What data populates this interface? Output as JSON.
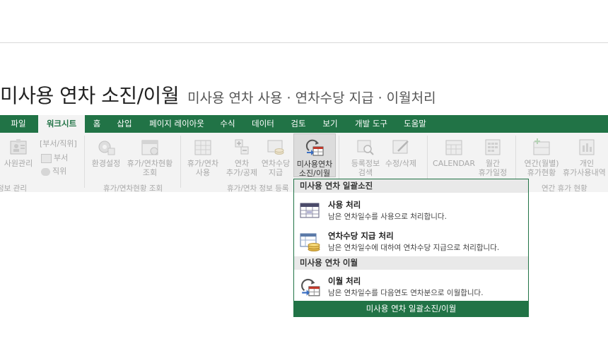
{
  "heading": {
    "title": "미사용 연차 소진/이월",
    "subtitle": "미사용 연차 사용 · 연차수당 지급  · 이월처리"
  },
  "tabs": [
    "파일",
    "워크시트",
    "홈",
    "삽입",
    "페이지 레이아웃",
    "수식",
    "데이터",
    "검토",
    "보기",
    "개발 도구",
    "도움말"
  ],
  "active_tab": "워크시트",
  "ribbon": {
    "buttons": {
      "employee_mgmt": "사원관리",
      "dept_pos": "[부서/직위]",
      "dept": "부서",
      "position": "직위",
      "env_settings": "환경설정",
      "leave_status_1": "휴가/연차현황",
      "leave_status_2": "조회",
      "leave_use_1": "휴가/연차",
      "leave_use_2": "사용",
      "annual_add_1": "연차",
      "annual_add_2": "추가/공제",
      "allowance_1": "연차수당",
      "allowance_2": "지급",
      "unused_1": "미사용연차",
      "unused_2": "소진/이월",
      "reg_search_1": "등록정보",
      "reg_search_2": "검색",
      "edit_delete": "수정/삭제",
      "calendar": "CALENDAR",
      "monthly_1": "월간",
      "monthly_2": "휴가일정",
      "annual_monthly_1": "연간(월별)",
      "annual_monthly_2": "휴가현황",
      "personal_1": "개인",
      "personal_2": "휴가사용내역"
    },
    "groups": {
      "g1": "정보 관리",
      "g2": "휴가/연차현황 조회",
      "g3": "휴가/연차 정보 등록",
      "g4": "연간 휴가 현황"
    }
  },
  "dropdown": {
    "section1": "미사용 연차 일괄소진",
    "item1_title": "사용 처리",
    "item1_desc": "남은 연차일수를 사용으로 처리합니다.",
    "item2_title": "연차수당 지급 처리",
    "item2_desc": "남은 연차일수에 대하여 연차수당 지급으로 처리합니다.",
    "section2": "미사용 연차 이월",
    "item3_title": "이월 처리",
    "item3_desc": "남은 연차일수를 다음연도 연차분으로 이월합니다.",
    "footer": "미사용 연차 일괄소진/이월"
  },
  "colors": {
    "excel_green": "#217346",
    "ribbon_bg": "#f3f3f3"
  }
}
